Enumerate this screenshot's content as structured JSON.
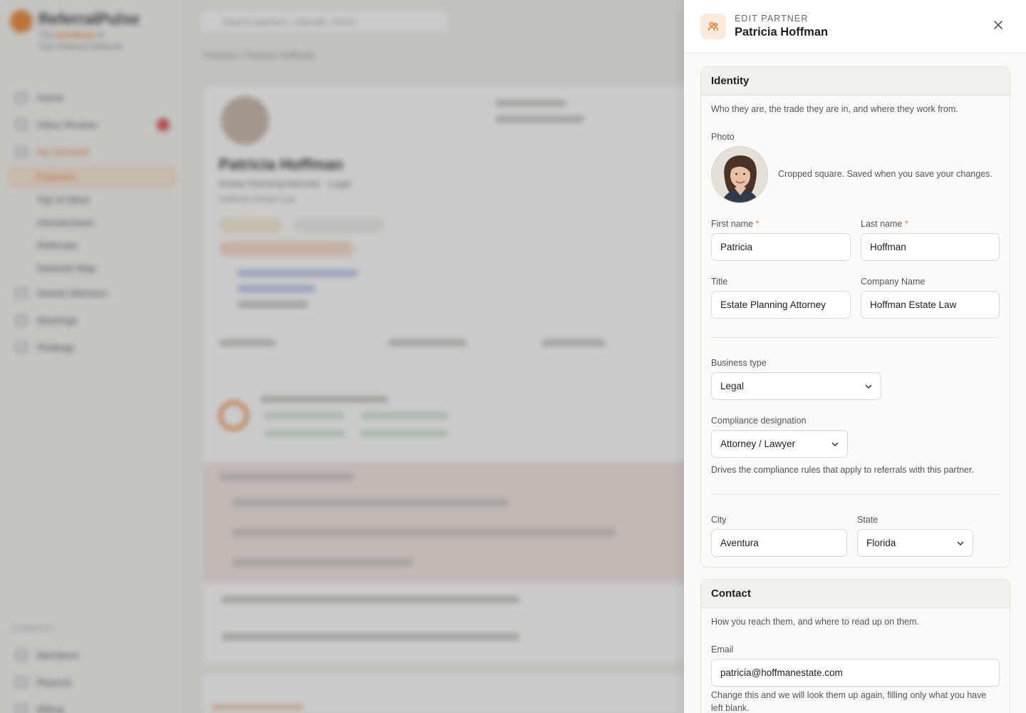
{
  "background": {
    "app_name": "ReferralPulse",
    "tagline_pre": "The",
    "tagline_em": "heartbeat",
    "tagline_post": "of",
    "tagline_line2": "Your Referral Network",
    "search_placeholder": "Search partners, referrals, intros...",
    "breadcrumb_section": "Partners",
    "breadcrumb_current": "Patricia Hoffman",
    "nav": [
      "Home",
      "Inbox Review",
      "My Network",
      "Partners",
      "Top of Mind",
      "Introductions",
      "Referrals",
      "Network Map",
      "Needs Attention",
      "Meetings",
      "Strategy"
    ],
    "section_company": "COMPANY",
    "nav_company": [
      "Members",
      "Reports",
      "Billing"
    ],
    "profile_name": "Patricia Hoffman",
    "profile_title": "Estate Planning Attorney · Legal",
    "profile_company": "Hoffman Estate Law"
  },
  "drawer": {
    "kicker": "EDIT PARTNER",
    "title": "Patricia Hoffman",
    "identity": {
      "heading": "Identity",
      "description": "Who they are, the trade they are in, and where they work from.",
      "photo_label": "Photo",
      "photo_hint": "Cropped square. Saved when you save your changes.",
      "first_name_label": "First name",
      "first_name": "Patricia",
      "last_name_label": "Last name",
      "last_name": "Hoffman",
      "required_mark": "*",
      "title_label": "Title",
      "title": "Estate Planning Attorney",
      "company_label": "Company Name",
      "company": "Hoffman Estate Law",
      "business_type_label": "Business type",
      "business_type": "Legal",
      "compliance_label": "Compliance designation",
      "compliance": "Attorney / Lawyer",
      "compliance_help": "Drives the compliance rules that apply to referrals with this partner.",
      "city_label": "City",
      "city": "Aventura",
      "state_label": "State",
      "state": "Florida"
    },
    "contact": {
      "heading": "Contact",
      "description": "How you reach them, and where to read up on them.",
      "email_label": "Email",
      "email": "patricia@hoffmanestate.com",
      "email_help": "Change this and we will look them up again, filling only what you have left blank."
    }
  },
  "colors": {
    "accent": "#e07a2e",
    "accent_soft": "#fcebdc",
    "border": "#dcd9d4"
  }
}
